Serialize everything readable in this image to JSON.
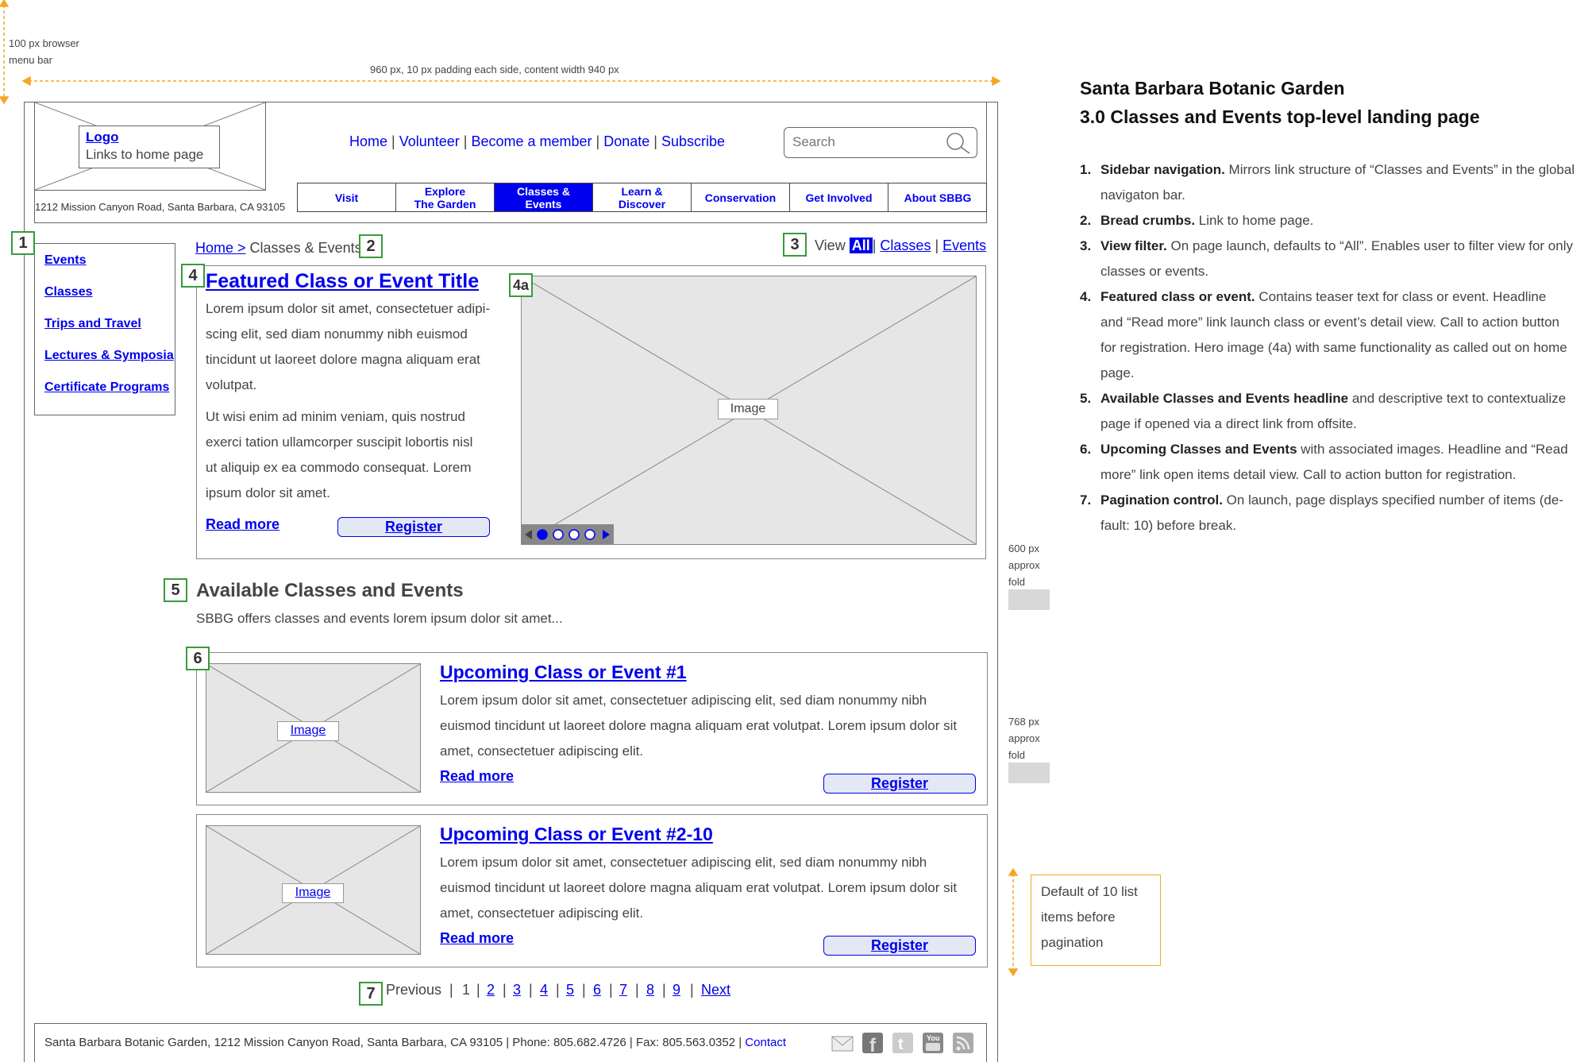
{
  "annotations": {
    "menu_bar_note": "100 px browser menu bar",
    "width_note": "960 px, 10 px padding each side, content width 940 px",
    "fold_600": "600 px approx fold",
    "fold_768": "768 px approx fold",
    "pagination_note": "Default of 10 list items before pagination"
  },
  "header": {
    "logo_link": "Logo",
    "logo_sub": "Links to home page",
    "address": "1212 Mission Canyon Road, Santa Barbara, CA 93105",
    "top_links": [
      "Home",
      "Volunteer",
      "Become a member",
      "Donate",
      "Subscribe"
    ],
    "search_placeholder": "Search",
    "nav": [
      {
        "l1": "Visit",
        "l2": ""
      },
      {
        "l1": "Explore",
        "l2": "The Garden"
      },
      {
        "l1": "Classes &",
        "l2": "Events"
      },
      {
        "l1": "Learn &",
        "l2": "Discover"
      },
      {
        "l1": "Conservation",
        "l2": ""
      },
      {
        "l1": "Get Involved",
        "l2": ""
      },
      {
        "l1": "About SBBG",
        "l2": ""
      }
    ],
    "active_color": "#0000ee"
  },
  "sidebar": {
    "items": [
      "Events",
      "Classes",
      "Trips and Travel",
      "Lectures & Symposia",
      "Certificate Programs"
    ]
  },
  "breadcrumb": {
    "home": "Home >",
    "current": "Classes & Events"
  },
  "view_filter": {
    "label": "View",
    "options": [
      "All",
      "Classes",
      "Events"
    ],
    "selected": "All"
  },
  "callouts": [
    "1",
    "2",
    "3",
    "4",
    "4a",
    "5",
    "6",
    "7"
  ],
  "featured": {
    "title": "Featured Class or Event Title",
    "para1": [
      "Lorem ipsum dolor sit amet, consectetuer adipi-",
      "scing elit, sed diam nonummy nibh euismod",
      "tincidunt ut laoreet dolore magna aliquam erat",
      "volutpat."
    ],
    "para2": [
      "Ut wisi enim ad minim veniam, quis nostrud",
      "exerci tation ullamcorper suscipit lobortis nisl",
      "ut aliquip ex ea commodo consequat. Lorem",
      "ipsum dolor sit amet."
    ],
    "read_more": "Read more",
    "register": "Register",
    "image_label": "Image"
  },
  "available": {
    "headline": "Available Classes and Events",
    "desc": "SBBG offers classes and events lorem ipsum dolor sit amet..."
  },
  "items": [
    {
      "title": "Upcoming Class or Event #1",
      "lines": [
        "Lorem ipsum dolor sit amet, consectetuer adipiscing elit, sed diam nonummy nibh",
        "euismod tincidunt ut laoreet dolore magna aliquam erat volutpat. Lorem ipsum dolor sit",
        "amet, consectetuer adipiscing elit."
      ],
      "read_more": "Read more",
      "register": "Register",
      "image_label": "Image"
    },
    {
      "title": "Upcoming Class or Event #2-10",
      "lines": [
        "Lorem ipsum dolor sit amet, consectetuer adipiscing elit, sed diam nonummy nibh",
        "euismod tincidunt ut laoreet dolore magna aliquam erat volutpat. Lorem ipsum dolor sit",
        "amet, consectetuer adipiscing elit."
      ],
      "read_more": "Read more",
      "register": "Register",
      "image_label": "Image"
    }
  ],
  "pagination": {
    "previous": "Previous",
    "current": "1",
    "pages": [
      "2",
      "3",
      "4",
      "5",
      "6",
      "7",
      "8",
      "9"
    ],
    "next": "Next"
  },
  "footer": {
    "text": "Santa Barbara Botanic Garden, 1212 Mission Canyon Road, Santa Barbara, CA 93105 | Phone: 805.682.4726 | Fax: 805.563.0352 |",
    "contact": "Contact",
    "social_icons": [
      "email-icon",
      "facebook-icon",
      "twitter-icon",
      "youtube-icon",
      "rss-icon"
    ]
  },
  "notes": {
    "title1": "Santa Barbara Botanic Garden",
    "title2": "3.0 Classes and Events top-level landing page",
    "items": [
      {
        "n": "1.",
        "lines": [
          [
            "Sidebar navigation.",
            " Mirrors link structure of “Classes and Events” in the global"
          ],
          [
            "",
            "navigaton bar."
          ]
        ]
      },
      {
        "n": "2.",
        "lines": [
          [
            "Bread crumbs.",
            " Link to home page."
          ]
        ]
      },
      {
        "n": "3.",
        "lines": [
          [
            "View filter.",
            " On page launch, defaults to “All”. Enables user to filter view for only"
          ],
          [
            "",
            "classes or events."
          ]
        ]
      },
      {
        "n": "4.",
        "lines": [
          [
            "Featured class or event.",
            " Contains teaser text for class or event. Headline"
          ],
          [
            "",
            "and “Read more” link launch class or event’s detail view. Call to action button"
          ],
          [
            "",
            "for registration. Hero image (4a) with same functionality as called out on home"
          ],
          [
            "",
            "page."
          ]
        ]
      },
      {
        "n": "5.",
        "lines": [
          [
            "Available Classes and Events headline",
            " and descriptive text to contextualize"
          ],
          [
            "",
            "page if opened via a direct link from offsite."
          ]
        ]
      },
      {
        "n": "6.",
        "lines": [
          [
            "Upcoming Classes and Events",
            " with associated images. Headline and “Read"
          ],
          [
            "",
            "more” link open items detail view. Call to action button for registration."
          ]
        ]
      },
      {
        "n": "7.",
        "lines": [
          [
            "Pagination control.",
            " On launch, page displays specified number of items (de-"
          ],
          [
            "",
            "fault: 10) before break."
          ]
        ]
      }
    ]
  }
}
